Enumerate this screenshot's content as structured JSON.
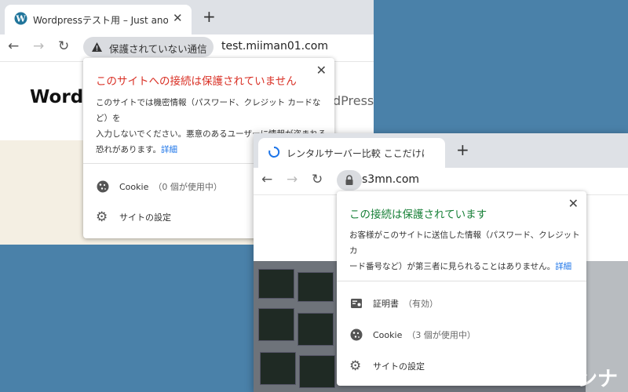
{
  "window1": {
    "tab_title": "Wordpressテスト用 – Just another",
    "url": "test.miiman01.com",
    "security_chip": "保護されていない通信",
    "page_heading": "Wordp",
    "page_heading_tail": "dPress",
    "popup": {
      "title": "このサイトへの接続は保護されていません",
      "desc_line1": "このサイトでは機密情報（パスワード、クレジット カードなど）を",
      "desc_line2": "入力しないでください。悪意のあるユーザーに情報が盗まれる",
      "desc_line3": "恐れがあります。",
      "detail_link": "詳細",
      "cookie_label": "Cookie",
      "cookie_count": "（0 個が使用中）",
      "site_settings": "サイトの設定"
    }
  },
  "window2": {
    "tab_title": "レンタルサーバー比較 ここだけは押さえ",
    "url": "s3mn.com",
    "page_overlay_text": "ンナ",
    "popup": {
      "title": "この接続は保護されています",
      "desc_line1": "お客様がこのサイトに送信した情報（パスワード、クレジット カ",
      "desc_line2": "ード番号など）が第三者に見られることはありません。",
      "detail_link": "詳細",
      "cert_label": "証明書",
      "cert_status": "（有効）",
      "cookie_label": "Cookie",
      "cookie_count": "（3 個が使用中）",
      "site_settings": "サイトの設定"
    }
  },
  "colors": {
    "desktop": "#4a81a9",
    "warning_red": "#d93025",
    "secure_green": "#188038",
    "link_blue": "#1a73e8"
  },
  "icons": [
    "wordpress-favicon",
    "loading-favicon",
    "back-arrow-icon",
    "forward-arrow-icon",
    "reload-icon",
    "warning-icon",
    "lock-icon",
    "close-icon",
    "cookie-icon",
    "gear-icon",
    "certificate-icon",
    "plus-icon"
  ]
}
